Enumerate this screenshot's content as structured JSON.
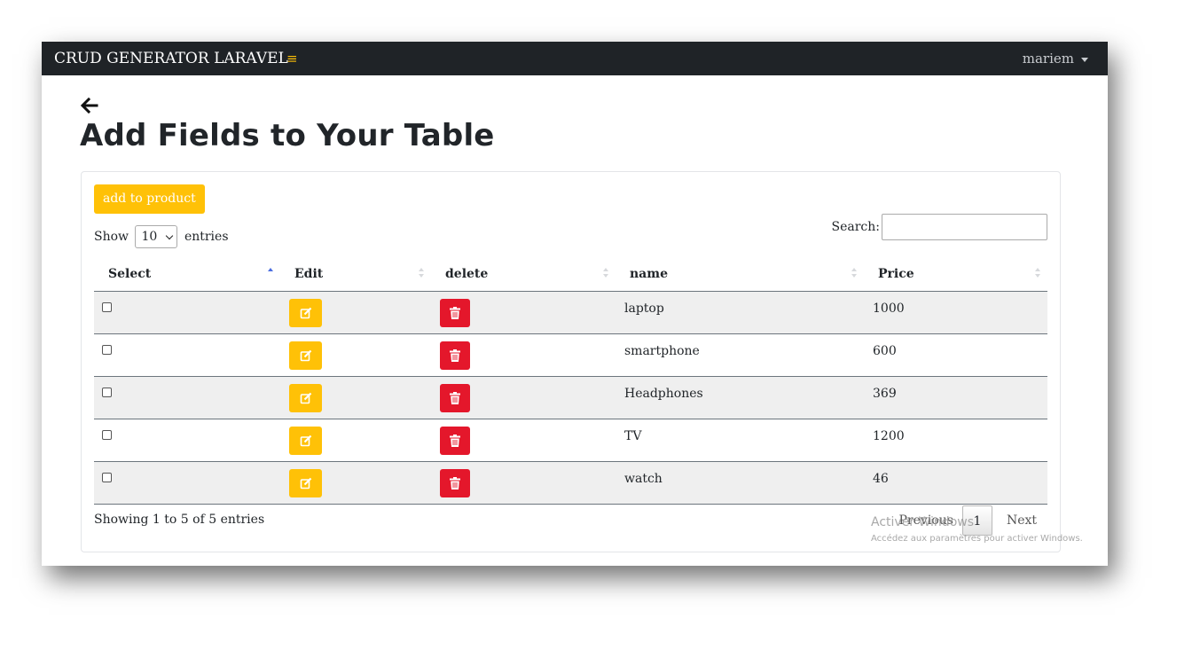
{
  "navbar": {
    "brand": "CRUD GENERATOR LARAVEL",
    "toggle_icon": "≡",
    "user": "mariem"
  },
  "page": {
    "title": "Add Fields to Your Table",
    "back_icon": "arrow-left-icon"
  },
  "card": {
    "add_button": "add to product",
    "length": {
      "show": "Show",
      "value": "10",
      "entries": "entries"
    },
    "search_label": "Search:",
    "columns": [
      "Select",
      "Edit",
      "delete",
      "name",
      "Price"
    ],
    "rows": [
      {
        "name": "laptop",
        "price": "1000"
      },
      {
        "name": "smartphone",
        "price": "600"
      },
      {
        "name": "Headphones",
        "price": "369"
      },
      {
        "name": "TV",
        "price": "1200"
      },
      {
        "name": "watch",
        "price": "46"
      }
    ],
    "info": "Showing 1 to 5 of 5 entries",
    "pager": {
      "previous": "Previous",
      "current": "1",
      "next": "Next"
    }
  },
  "watermark": {
    "line1": "Activer Windows",
    "line2": "Accédez aux paramètres pour activer Windows."
  },
  "colors": {
    "navbar": "#1f2327",
    "warning": "#ffc107",
    "danger": "#e4172b"
  }
}
